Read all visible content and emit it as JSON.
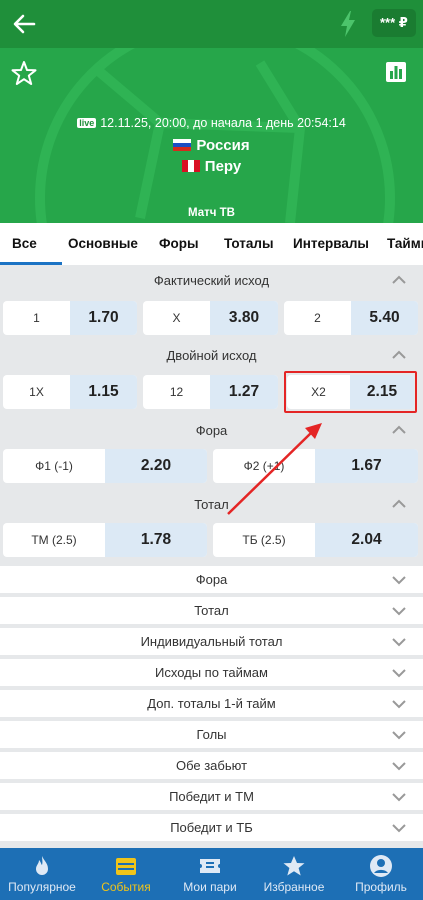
{
  "header": {
    "balance": "*** ₽",
    "colors": {
      "bar": "#1f8f3a",
      "hero": "#26a64a"
    }
  },
  "match": {
    "live_badge": "live",
    "datetime": "12.11.25, 20:00, до начала  1 день  20:54:14",
    "team1": "Россия",
    "team2": "Перу",
    "tv": "Матч ТВ"
  },
  "tabs": [
    {
      "label": "Все",
      "active": true
    },
    {
      "label": "Основные"
    },
    {
      "label": "Форы"
    },
    {
      "label": "Тоталы"
    },
    {
      "label": "Интервалы"
    },
    {
      "label": "Таймы"
    }
  ],
  "markets": {
    "fact": {
      "title": "Фактический исход",
      "odds": [
        {
          "label": "1",
          "value": "1.70"
        },
        {
          "label": "X",
          "value": "3.80"
        },
        {
          "label": "2",
          "value": "5.40"
        }
      ]
    },
    "double": {
      "title": "Двойной исход",
      "odds": [
        {
          "label": "1X",
          "value": "1.15"
        },
        {
          "label": "12",
          "value": "1.27"
        },
        {
          "label": "X2",
          "value": "2.15"
        }
      ]
    },
    "handicap": {
      "title": "Фора",
      "odds": [
        {
          "label": "Ф1 (-1)",
          "value": "2.20"
        },
        {
          "label": "Ф2 (+1)",
          "value": "1.67"
        }
      ]
    },
    "total": {
      "title": "Тотал",
      "odds": [
        {
          "label": "ТМ (2.5)",
          "value": "1.78"
        },
        {
          "label": "ТБ (2.5)",
          "value": "2.04"
        }
      ]
    }
  },
  "collapsed_markets": [
    "Фора",
    "Тотал",
    "Индивидуальный тотал",
    "Исходы по таймам",
    "Доп. тоталы 1-й тайм",
    "Голы",
    "Обе забьют",
    "Победит и ТМ",
    "Победит и ТБ"
  ],
  "bottom_nav": [
    {
      "label": "Популярное",
      "icon": "flame-icon"
    },
    {
      "label": "События",
      "icon": "calendar-icon",
      "active": true
    },
    {
      "label": "Мои пари",
      "icon": "ticket-icon"
    },
    {
      "label": "Избранное",
      "icon": "star-icon"
    },
    {
      "label": "Профиль",
      "icon": "profile-icon"
    }
  ],
  "colors": {
    "accent_blue": "#1d6fb5",
    "active_nav": "#f0c419",
    "highlight": "#e42525"
  }
}
